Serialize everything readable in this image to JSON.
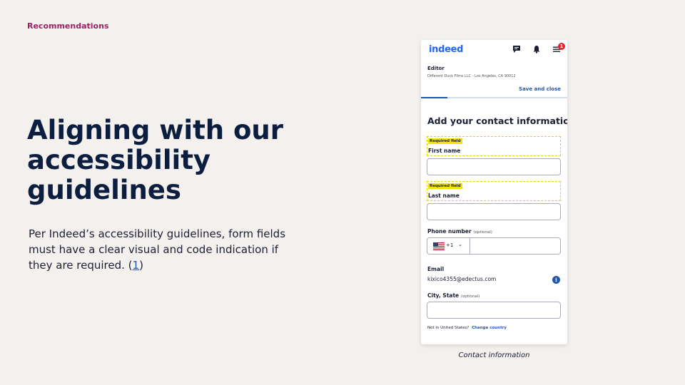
{
  "slide": {
    "kicker": "Recommendations",
    "headline": "Aligning with our accessibility guidelines",
    "body_text": "Per Indeed’s accessibility guidelines, form fields must have a clear visual and code indication if they are required. (",
    "ref_link": "1",
    "body_close": ")",
    "caption": "Contact information"
  },
  "app": {
    "logo": "indeed",
    "notification_count": "1",
    "icons": [
      "messages-icon",
      "bell-icon",
      "menu-icon"
    ],
    "job_title": "Editor",
    "job_subtitle": "Different Duck Films LLC - Los Angeles, CA 90012",
    "save_close": "Save and close",
    "progress_percent": 18,
    "form_title": "Add your contact information",
    "required_tag": "Required field",
    "first_name_label": "First name",
    "last_name_label": "Last name",
    "phone_label": "Phone number",
    "optional_tag": "(optional)",
    "country_code": "+1",
    "email_label": "Email",
    "email_value": "kixico4355@edectus.com",
    "city_label": "City, State",
    "not_in_us": "Not in United States?",
    "change_country": "Change country"
  },
  "colors": {
    "accent": "#2557a7",
    "kicker": "#9b2263",
    "required_highlight": "#f2e300",
    "badge": "#e0262e"
  }
}
